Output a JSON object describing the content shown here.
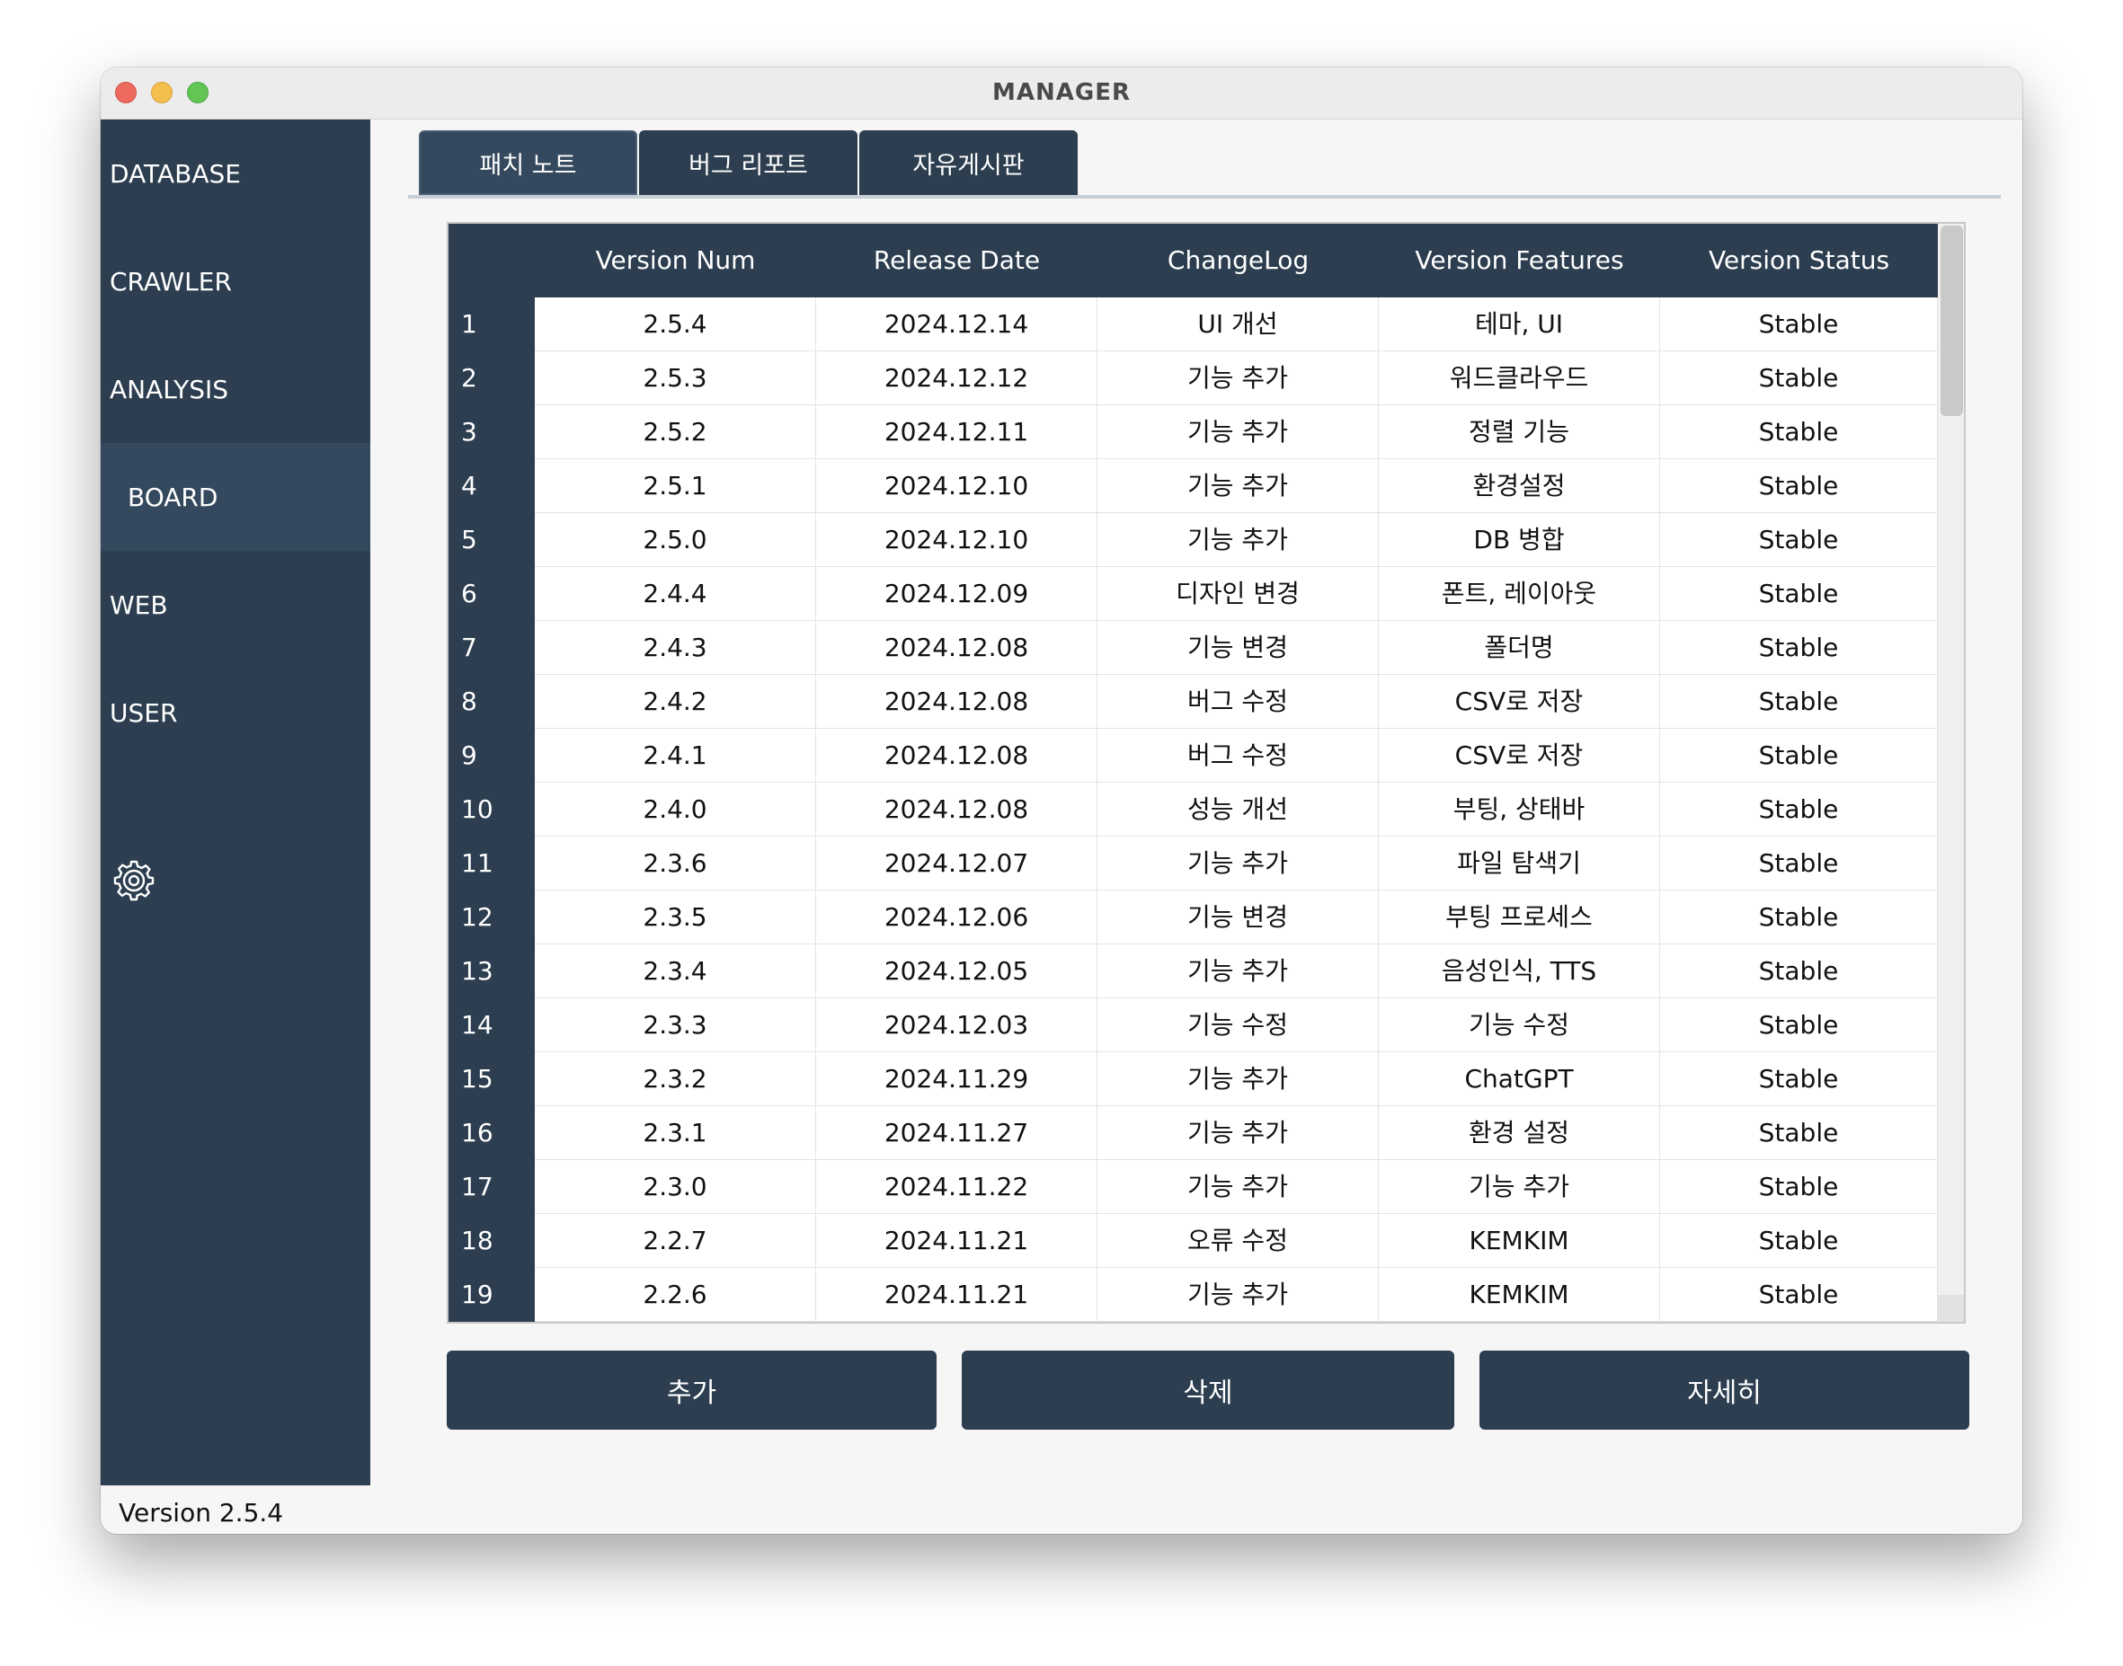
{
  "window": {
    "title": "MANAGER"
  },
  "sidebar": {
    "items": [
      {
        "label": "DATABASE",
        "active": false
      },
      {
        "label": "CRAWLER",
        "active": false
      },
      {
        "label": "ANALYSIS",
        "active": false
      },
      {
        "label": "BOARD",
        "active": true
      },
      {
        "label": "WEB",
        "active": false
      },
      {
        "label": "USER",
        "active": false
      }
    ],
    "settings_icon": "gear-icon"
  },
  "tabs": [
    {
      "label": "패치 노트",
      "active": true
    },
    {
      "label": "버그 리포트",
      "active": false
    },
    {
      "label": "자유게시판",
      "active": false
    }
  ],
  "table": {
    "columns": [
      "Version Num",
      "Release Date",
      "ChangeLog",
      "Version Features",
      "Version Status"
    ],
    "rows": [
      {
        "num": "1",
        "version": "2.5.4",
        "date": "2024.12.14",
        "changelog": "UI 개선",
        "features": "테마, UI",
        "status": "Stable"
      },
      {
        "num": "2",
        "version": "2.5.3",
        "date": "2024.12.12",
        "changelog": "기능 추가",
        "features": "워드클라우드",
        "status": "Stable"
      },
      {
        "num": "3",
        "version": "2.5.2",
        "date": "2024.12.11",
        "changelog": "기능 추가",
        "features": "정렬 기능",
        "status": "Stable"
      },
      {
        "num": "4",
        "version": "2.5.1",
        "date": "2024.12.10",
        "changelog": "기능 추가",
        "features": "환경설정",
        "status": "Stable"
      },
      {
        "num": "5",
        "version": "2.5.0",
        "date": "2024.12.10",
        "changelog": "기능 추가",
        "features": "DB 병합",
        "status": "Stable"
      },
      {
        "num": "6",
        "version": "2.4.4",
        "date": "2024.12.09",
        "changelog": "디자인 변경",
        "features": "폰트, 레이아웃",
        "status": "Stable"
      },
      {
        "num": "7",
        "version": "2.4.3",
        "date": "2024.12.08",
        "changelog": "기능 변경",
        "features": "폴더명",
        "status": "Stable"
      },
      {
        "num": "8",
        "version": "2.4.2",
        "date": "2024.12.08",
        "changelog": "버그 수정",
        "features": "CSV로 저장",
        "status": "Stable"
      },
      {
        "num": "9",
        "version": "2.4.1",
        "date": "2024.12.08",
        "changelog": "버그 수정",
        "features": "CSV로 저장",
        "status": "Stable"
      },
      {
        "num": "10",
        "version": "2.4.0",
        "date": "2024.12.08",
        "changelog": "성능 개선",
        "features": "부팅, 상태바",
        "status": "Stable"
      },
      {
        "num": "11",
        "version": "2.3.6",
        "date": "2024.12.07",
        "changelog": "기능 추가",
        "features": "파일 탐색기",
        "status": "Stable"
      },
      {
        "num": "12",
        "version": "2.3.5",
        "date": "2024.12.06",
        "changelog": "기능 변경",
        "features": "부팅 프로세스",
        "status": "Stable"
      },
      {
        "num": "13",
        "version": "2.3.4",
        "date": "2024.12.05",
        "changelog": "기능 추가",
        "features": "음성인식, TTS",
        "status": "Stable"
      },
      {
        "num": "14",
        "version": "2.3.3",
        "date": "2024.12.03",
        "changelog": "기능 수정",
        "features": "기능 수정",
        "status": "Stable"
      },
      {
        "num": "15",
        "version": "2.3.2",
        "date": "2024.11.29",
        "changelog": "기능 추가",
        "features": "ChatGPT",
        "status": "Stable"
      },
      {
        "num": "16",
        "version": "2.3.1",
        "date": "2024.11.27",
        "changelog": "기능 추가",
        "features": "환경 설정",
        "status": "Stable"
      },
      {
        "num": "17",
        "version": "2.3.0",
        "date": "2024.11.22",
        "changelog": "기능 추가",
        "features": "기능 추가",
        "status": "Stable"
      },
      {
        "num": "18",
        "version": "2.2.7",
        "date": "2024.11.21",
        "changelog": "오류 수정",
        "features": "KEMKIM",
        "status": "Stable"
      },
      {
        "num": "19",
        "version": "2.2.6",
        "date": "2024.11.21",
        "changelog": "기능 추가",
        "features": "KEMKIM",
        "status": "Stable"
      }
    ]
  },
  "buttons": {
    "add": "추가",
    "delete": "삭제",
    "detail": "자세히"
  },
  "footer": {
    "version": "Version 2.5.4"
  },
  "colors": {
    "navy": "#2c3e50",
    "navy_active": "#34495e"
  }
}
